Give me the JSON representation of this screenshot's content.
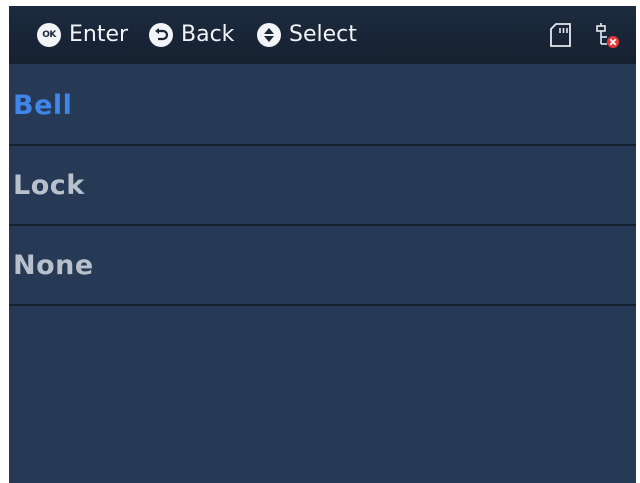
{
  "header": {
    "hints": [
      {
        "icon": "ok-icon",
        "icon_text": "OK",
        "label": "Enter"
      },
      {
        "icon": "back-icon",
        "label": "Back"
      },
      {
        "icon": "up-down-icon",
        "label": "Select"
      }
    ],
    "status_icons": [
      "sd-card-icon",
      "network-disconnected-icon"
    ]
  },
  "menu": {
    "items": [
      {
        "label": "Bell",
        "selected": true
      },
      {
        "label": "Lock",
        "selected": false
      },
      {
        "label": "None",
        "selected": false
      }
    ]
  },
  "colors": {
    "background": "#263a56",
    "header": "#1a2638",
    "selected_text": "#3f86e8",
    "normal_text": "#b8c0cb",
    "divider": "#16212f",
    "error": "#e5393c"
  }
}
